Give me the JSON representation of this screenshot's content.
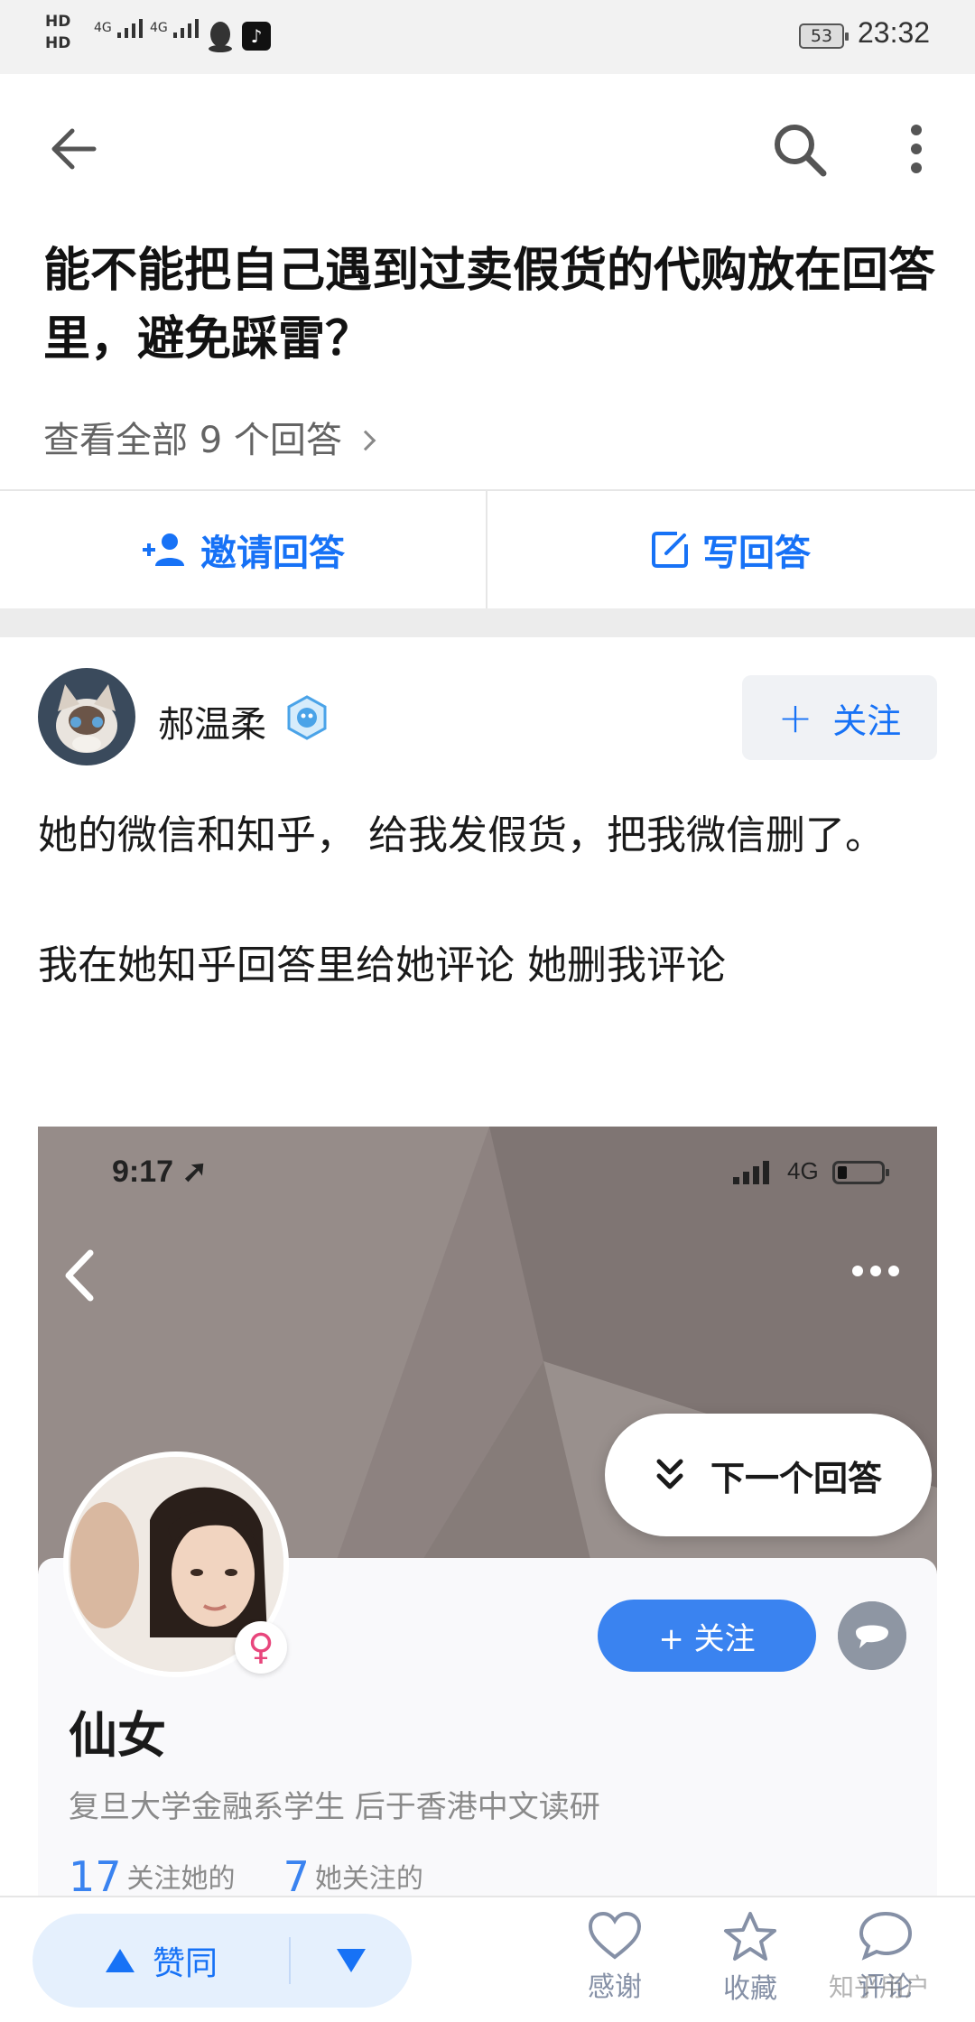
{
  "status_bar": {
    "hd1": "HD",
    "hd2": "HD",
    "signal1": "4G",
    "signal2": "4G",
    "battery": "53",
    "time": "23:32"
  },
  "nav": {
    "back_icon": "back-arrow-icon",
    "search_icon": "search-icon",
    "more_icon": "more-vertical-icon"
  },
  "question": {
    "title": "能不能把自己遇到过卖假货的代购放在回答里，避免踩雷？",
    "view_all": "查看全部 9 个回答"
  },
  "actions": {
    "invite": "邀请回答",
    "write": "写回答"
  },
  "answer": {
    "author_name": "郝温柔",
    "follow_label": "关注",
    "paragraphs": [
      "她的微信和知乎， 给我发假货，把我微信删了。",
      "我在她知乎回答里给她评论 她删我评论"
    ]
  },
  "embedded": {
    "time": "9:17",
    "network": "4G",
    "next_answer": "下一个回答",
    "follow_label": "+ 关注",
    "profile_name": "仙女",
    "bio": "复旦大学金融系学生 后于香港中文读研",
    "following_me_count": "17",
    "following_me_label": "关注她的",
    "she_follows_count": "7",
    "she_follows_label": "她关注的"
  },
  "bottom_bar": {
    "upvote": "赞同",
    "thanks": "感谢",
    "collect": "收藏",
    "comment": "评论"
  },
  "watermark": "知乎用户",
  "colors": {
    "accent": "#1772f6",
    "muted": "#8590a6"
  }
}
